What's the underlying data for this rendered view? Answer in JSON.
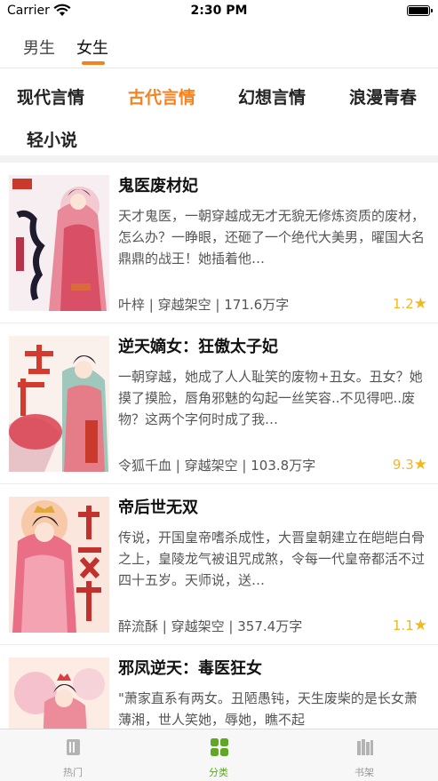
{
  "status_bar": {
    "carrier": "Carrier",
    "time": "2:30 PM",
    "battery_level": 1.0
  },
  "gender_tabs": [
    {
      "label": "男生",
      "active": false
    },
    {
      "label": "女生",
      "active": true
    }
  ],
  "categories": [
    {
      "label": "现代言情",
      "active": false
    },
    {
      "label": "古代言情",
      "active": true
    },
    {
      "label": "幻想言情",
      "active": false
    },
    {
      "label": "浪漫青春",
      "active": false
    },
    {
      "label": "轻小说",
      "active": false
    }
  ],
  "books": [
    {
      "title": "鬼医废材妃",
      "description": "天才鬼医，一朝穿越成无才无貌无修炼资质的废材，怎么办？一睁眼，还砸了一个绝代大美男，曜国大名鼎鼎的战王！她插着他…",
      "author": "叶梓",
      "genre": "穿越架空",
      "words": "171.6万字",
      "rating": "1.2"
    },
    {
      "title": "逆天嫡女：狂傲太子妃",
      "description": "一朝穿越，她成了人人耻笑的废物+丑女。丑女？她摸了摸脸，唇角邪魅的勾起一丝笑容..不见得吧..废物？这两个字何时成了我…",
      "author": "令狐千血",
      "genre": "穿越架空",
      "words": "103.8万字",
      "rating": "9.3"
    },
    {
      "title": "帝后世无双",
      "description": "传说，开国皇帝嗜杀成性，大晋皇朝建立在皑皑白骨之上，皇陵龙气被诅咒成煞，令每一代皇帝都活不过四十五岁。天师说，送…",
      "author": "醉流酥",
      "genre": "穿越架空",
      "words": "357.4万字",
      "rating": "1.1"
    },
    {
      "title": "邪凤逆天：毒医狂女",
      "description": "\"萧家直系有两女。丑陋愚钝，天生废柴的是长女萧薄湘，世人笑她，辱她，瞧不起",
      "author": "",
      "genre": "",
      "words": "",
      "rating": ""
    }
  ],
  "tab_bar": [
    {
      "label": "热门",
      "icon": "book-icon",
      "active": false
    },
    {
      "label": "分类",
      "icon": "grid-icon",
      "active": true
    },
    {
      "label": "书架",
      "icon": "bookshelf-icon",
      "active": false
    }
  ],
  "colors": {
    "accent": "#f5821f",
    "tab_active": "#5fa825",
    "star": "#f2b81f"
  }
}
